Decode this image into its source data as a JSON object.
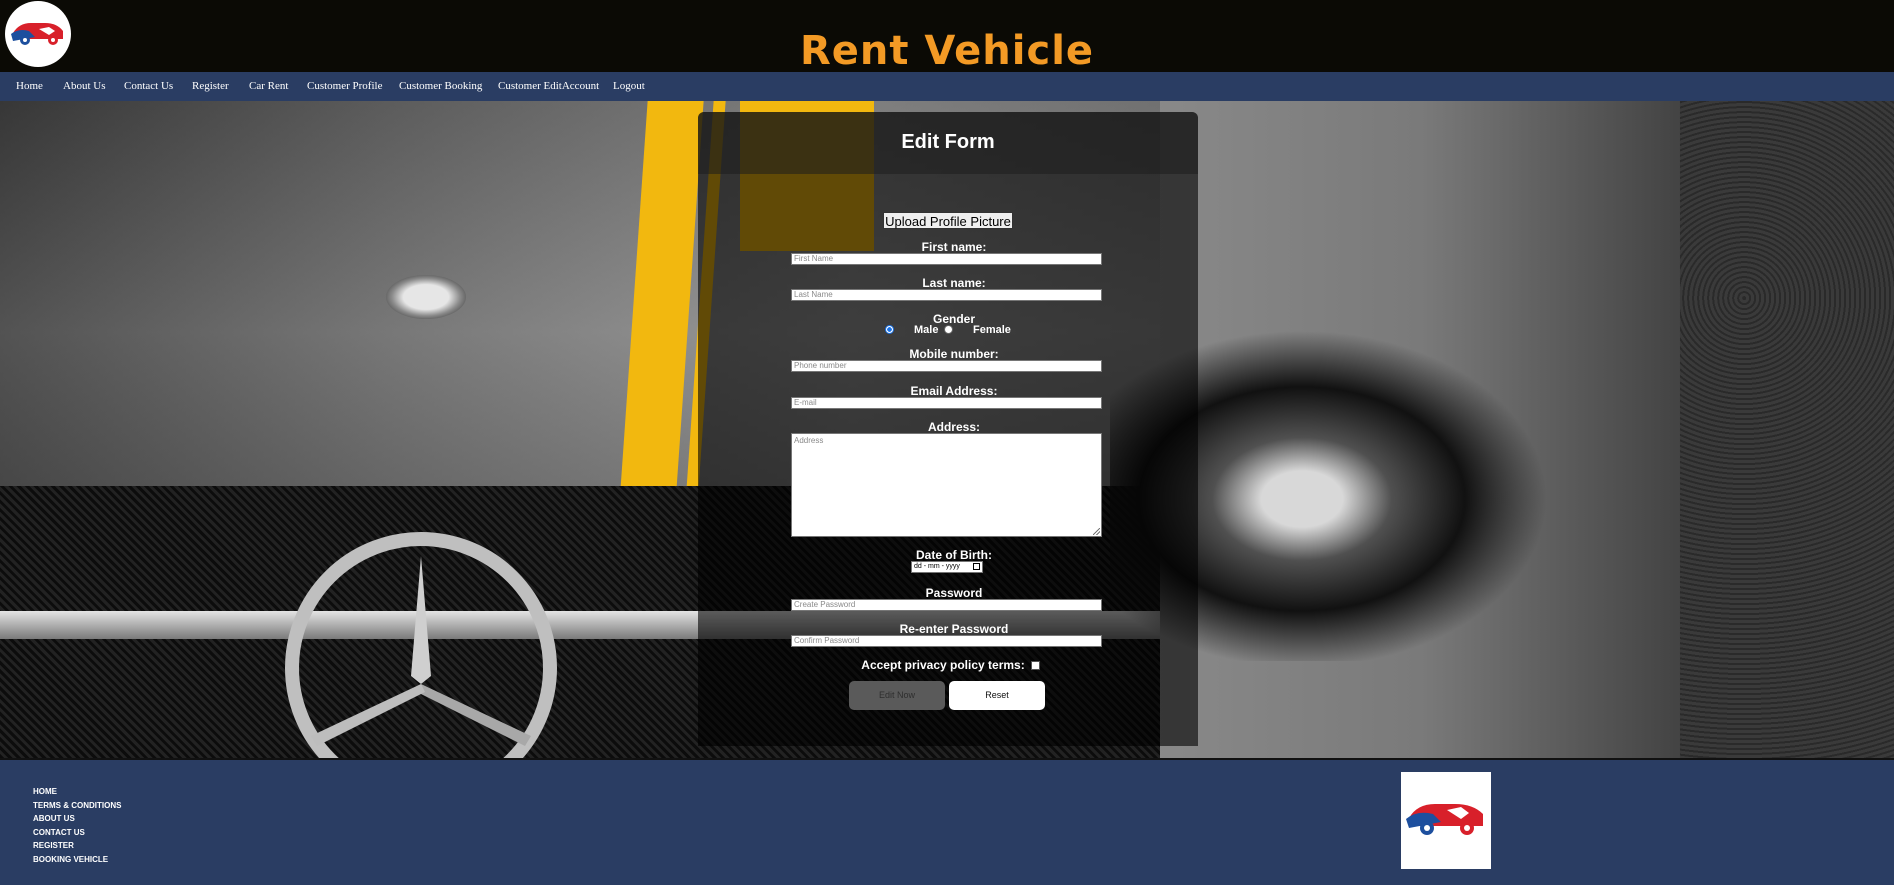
{
  "header": {
    "title": "Rent Vehicle",
    "logo_icon": "car-handshake-logo"
  },
  "nav": {
    "items": [
      {
        "label": "Home"
      },
      {
        "label": "About Us"
      },
      {
        "label": "Contact Us"
      },
      {
        "label": "Register"
      },
      {
        "label": "Car Rent"
      },
      {
        "label": "Customer Profile"
      },
      {
        "label": "Customer Booking"
      },
      {
        "label": "Customer EditAccount"
      },
      {
        "label": "Logout"
      }
    ]
  },
  "form": {
    "title": "Edit Form",
    "upload_label": "Upload Profile Picture",
    "first_name": {
      "label": "First name:",
      "placeholder": "First Name"
    },
    "last_name": {
      "label": "Last name:",
      "placeholder": "Last Name"
    },
    "gender": {
      "label": "Gender",
      "options": [
        "Male",
        "Female"
      ],
      "selected": "Male"
    },
    "mobile": {
      "label": "Mobile number:",
      "placeholder": "Phone number"
    },
    "email": {
      "label": "Email Address:",
      "placeholder": "E-mail"
    },
    "address": {
      "label": "Address:",
      "placeholder": "Address"
    },
    "dob": {
      "label": "Date of Birth:",
      "placeholder": "dd - mm - yyyy"
    },
    "password": {
      "label": "Password",
      "placeholder": "Create Password"
    },
    "reenter_password": {
      "label": "Re-enter Password",
      "placeholder": "Confirm Password"
    },
    "privacy": {
      "label": "Accept privacy policy terms:",
      "checked": false
    },
    "submit_label": "Edit Now",
    "reset_label": "Reset"
  },
  "footer": {
    "links": [
      {
        "label": "HOME"
      },
      {
        "label": "TERMS & CONDITIONS"
      },
      {
        "label": "ABOUT US"
      },
      {
        "label": "CONTACT US"
      },
      {
        "label": "REGISTER"
      },
      {
        "label": "BOOKING VEHICLE"
      }
    ],
    "logo_icon": "car-handshake-logo"
  },
  "colors": {
    "header_bg": "#0b0a05",
    "title": "#f39a25",
    "nav_bg": "#2a3d63",
    "footer_bg": "#2a3d63",
    "stripe": "#f2b80f"
  }
}
